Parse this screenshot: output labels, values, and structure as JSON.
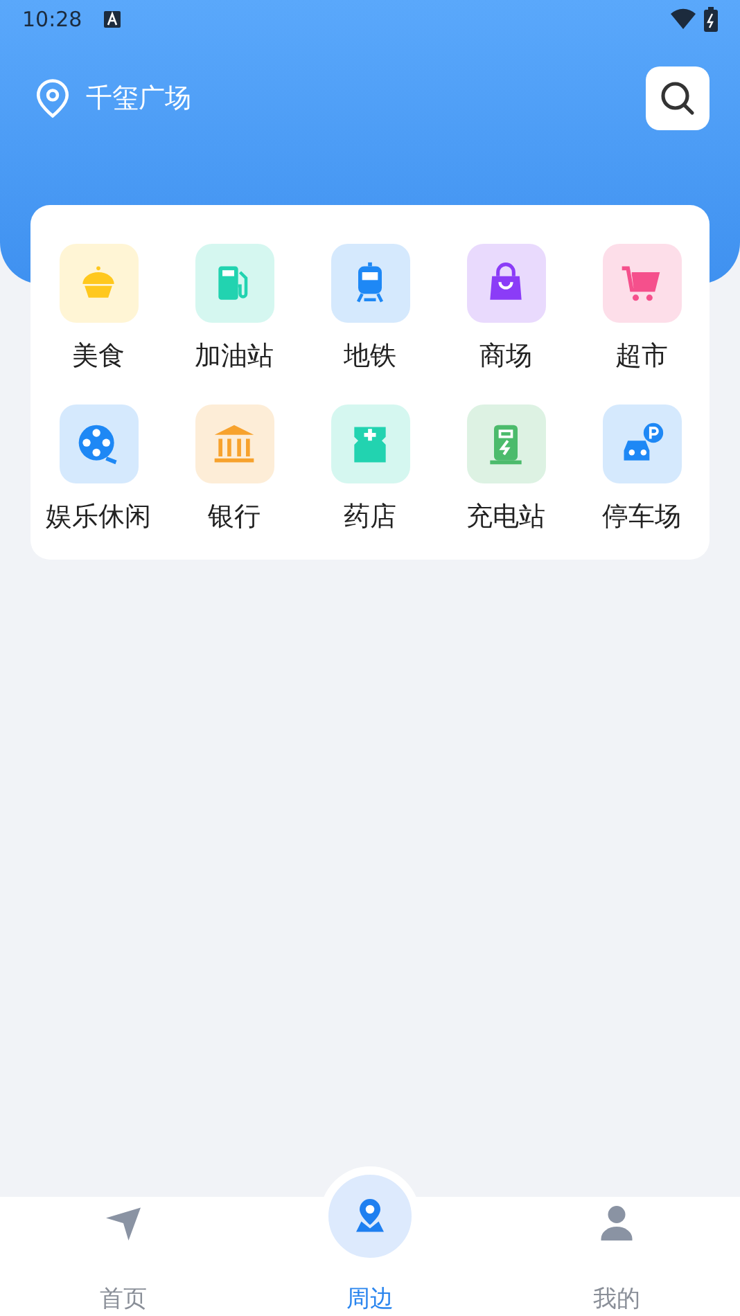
{
  "status_bar": {
    "time": "10:28"
  },
  "header": {
    "location": "千玺广场"
  },
  "categories": [
    {
      "kind": "food",
      "label": "美食",
      "color": "#ffc81e"
    },
    {
      "kind": "fuel",
      "label": "加油站",
      "color": "#22d3b0"
    },
    {
      "kind": "metro",
      "label": "地铁",
      "color": "#1e88f5"
    },
    {
      "kind": "mall",
      "label": "商场",
      "color": "#8b3cf7"
    },
    {
      "kind": "market",
      "label": "超市",
      "color": "#f5508c"
    },
    {
      "kind": "leisure",
      "label": "娱乐休闲",
      "color": "#1e88f5"
    },
    {
      "kind": "bank",
      "label": "银行",
      "color": "#f7a22d"
    },
    {
      "kind": "pharmacy",
      "label": "药店",
      "color": "#22d3b0"
    },
    {
      "kind": "charging",
      "label": "充电站",
      "color": "#4cbb6c"
    },
    {
      "kind": "parking",
      "label": "停车场",
      "color": "#1e88f5"
    }
  ],
  "tabs": [
    {
      "kind": "home",
      "label": "首页",
      "selected": false
    },
    {
      "kind": "nearby",
      "label": "周边",
      "selected": true
    },
    {
      "kind": "mine",
      "label": "我的",
      "selected": false
    }
  ]
}
